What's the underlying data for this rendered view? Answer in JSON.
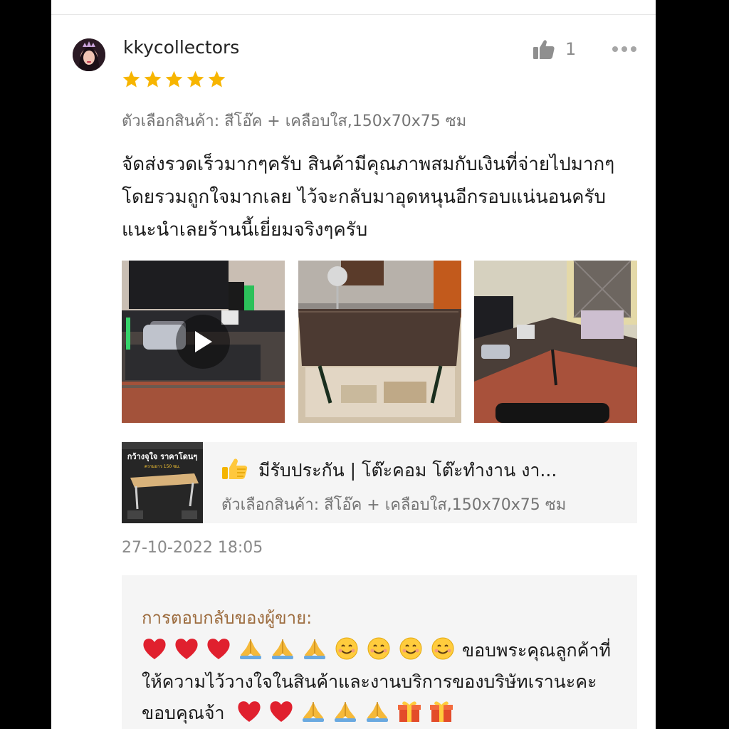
{
  "review": {
    "username": "kkycollectors",
    "like_count": "1",
    "rating": 5,
    "variation": "ตัวเลือกสินค้า: สีโอ๊ค + เคลือบใส,150x70x75 ซม",
    "text": "จัดส่งรวดเร็วมากๆครับ สินค้ามีคุณภาพสมกับเงินที่จ่ายไปมากๆ โดยรวมถูกใจมากเลย ไว้จะกลับมาอุดหนุนอีกรอบแน่นอนครับ แนะนำเลยร้านนี้เยี่ยมจริงๆครับ",
    "timestamp": "27-10-2022 18:05"
  },
  "product": {
    "name": "มีรับประกัน | โต๊ะคอม โต๊ะทำงาน งา...",
    "variation": "ตัวเลือกสินค้า: สีโอ๊ค + เคลือบใส,150x70x75 ซม",
    "thumb_title": "กว้างจุใจ ราคาโดนๆ",
    "thumb_sub": "ความยาว 150 ซม."
  },
  "seller_reply": {
    "title": "การตอบกลับของผู้ขาย:",
    "text_1": "ขอบพระคุณลูกค้าที่ให้ความไว้วางใจในสินค้าและงานบริการของบริษัทเรานะคะ ขอบคุณจ้า"
  },
  "icons": {
    "like": "thumbs-up-icon",
    "more": "more-dots-icon",
    "play": "play-icon",
    "star": "star-icon"
  },
  "colors": {
    "star": "#f7b500",
    "reply_title": "#9c6b3d",
    "muted": "#757575"
  }
}
